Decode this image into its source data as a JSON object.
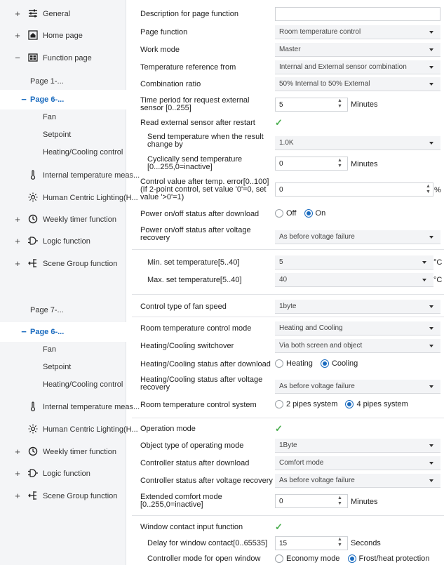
{
  "nav_top": {
    "general": "General",
    "home_page": "Home page",
    "function_page": "Function page",
    "page1": "Page 1-...",
    "page6": "Page 6-...",
    "fan": "Fan",
    "setpoint": "Setpoint",
    "heating_cooling": "Heating/Cooling control",
    "internal_temp": "Internal temperature meas...",
    "hcl": "Human Centric Lighting(H...",
    "weekly": "Weekly timer function",
    "logic": "Logic function",
    "scene": "Scene Group function"
  },
  "nav_bottom": {
    "page7": "Page 7-...",
    "page6": "Page 6-...",
    "fan": "Fan",
    "setpoint": "Setpoint",
    "heating_cooling": "Heating/Cooling control",
    "internal_temp": "Internal temperature meas...",
    "hcl": "Human Centric Lighting(H...",
    "weekly": "Weekly timer function",
    "logic": "Logic function",
    "scene": "Scene Group function"
  },
  "params": {
    "description": {
      "label": "Description for page function",
      "value": ""
    },
    "page_function": {
      "label": "Page function",
      "value": "Room temperature control"
    },
    "work_mode": {
      "label": "Work mode",
      "value": "Master"
    },
    "temp_ref": {
      "label": "Temperature reference from",
      "value": "Internal and External sensor combination"
    },
    "combination": {
      "label": "Combination ratio",
      "value": "50% Internal to 50% External"
    },
    "time_period": {
      "label": "Time period for request external sensor [0..255]",
      "value": "5",
      "unit": "Minutes"
    },
    "read_ext": {
      "label": "Read external sensor after restart",
      "value": "✓"
    },
    "send_temp_change": {
      "label": "Send temperature when the result change by",
      "value": "1.0K"
    },
    "cyclic_send": {
      "label": "Cyclically send temperature [0...255,0=inactive]",
      "value": "0",
      "unit": "Minutes"
    },
    "control_value": {
      "label": "Control value after temp. error[0..100] (If 2-point control, set value '0'=0, set value '>0'=1)",
      "value": "0",
      "unit": "%"
    },
    "power_download": {
      "label": "Power on/off status after download",
      "opt1": "Off",
      "opt2": "On"
    },
    "power_recovery": {
      "label": "Power on/off status after voltage recovery",
      "value": "As before voltage failure"
    },
    "min_set": {
      "label": "Min. set temperature[5..40]",
      "value": "5",
      "unit": "°C"
    },
    "max_set": {
      "label": "Max. set temperature[5..40]",
      "value": "40",
      "unit": "°C"
    },
    "fan_speed_type": {
      "label": "Control type of fan speed",
      "value": "1byte"
    },
    "rtc_mode": {
      "label": "Room temperature control mode",
      "value": "Heating and Cooling"
    },
    "hc_switchover": {
      "label": "Heating/Cooling switchover",
      "value": "Via both screen and object"
    },
    "hc_status_download": {
      "label": "Heating/Cooling status after download",
      "opt1": "Heating",
      "opt2": "Cooling"
    },
    "hc_status_recovery": {
      "label": "Heating/Cooling status after voltage recovery",
      "value": "As before voltage failure"
    },
    "rtc_system": {
      "label": "Room temperature control system",
      "opt1": "2 pipes system",
      "opt2": "4 pipes system"
    },
    "operation_mode": {
      "label": "Operation mode",
      "value": "✓"
    },
    "object_type": {
      "label": "Object type of operating mode",
      "value": "1Byte"
    },
    "ctrl_status_download": {
      "label": "Controller status after download",
      "value": "Comfort mode"
    },
    "ctrl_status_recovery": {
      "label": "Controller status after voltage recovery",
      "value": "As before voltage failure"
    },
    "ext_comfort": {
      "label": "Extended comfort mode [0..255,0=inactive]",
      "value": "0",
      "unit": "Minutes"
    },
    "window_contact": {
      "label": "Window contact input function",
      "value": "✓"
    },
    "window_delay": {
      "label": "Delay for window contact[0..65535]",
      "value": "15",
      "unit": "Seconds"
    },
    "open_window_mode": {
      "label": "Controller mode for open window",
      "opt1": "Economy mode",
      "opt2": "Frost/heat protection"
    }
  },
  "colors": {
    "accent": "#1a6bbf",
    "check": "#4caf50"
  }
}
